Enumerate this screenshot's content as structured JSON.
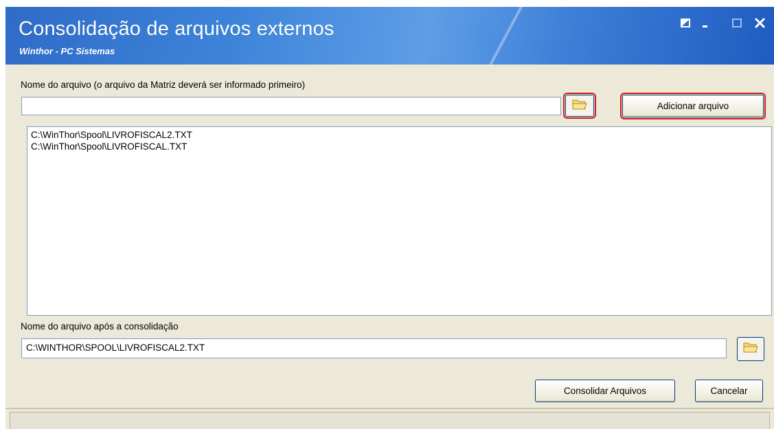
{
  "window": {
    "title": "Consolidação de arquivos externos",
    "subtitle": "Winthor - PC Sistemas"
  },
  "source": {
    "label": "Nome do arquivo (o arquivo da Matriz deverá ser informado primeiro)",
    "value": "",
    "add_button": {
      "label": "Adicionar arquivo"
    }
  },
  "file_list": {
    "items": [
      "C:\\WinThor\\Spool\\LIVROFISCAL2.TXT",
      "C:\\WinThor\\Spool\\LIVROFISCAL.TXT"
    ]
  },
  "target": {
    "label": "Nome do arquivo após a consolidação",
    "value": "C:\\WINTHOR\\SPOOL\\LIVROFISCAL2.TXT"
  },
  "actions": {
    "consolidate_label": "Consolidar Arquivos",
    "cancel_label": "Cancelar"
  },
  "icons": {
    "folder": "folder-open-icon",
    "window_controls": [
      "restore-icon",
      "minimize-icon",
      "maximize-icon",
      "close-icon"
    ]
  },
  "colors": {
    "titlebar": "#3d84d9",
    "highlight": "#d21616",
    "dialog_bg": "#ece9d8"
  }
}
